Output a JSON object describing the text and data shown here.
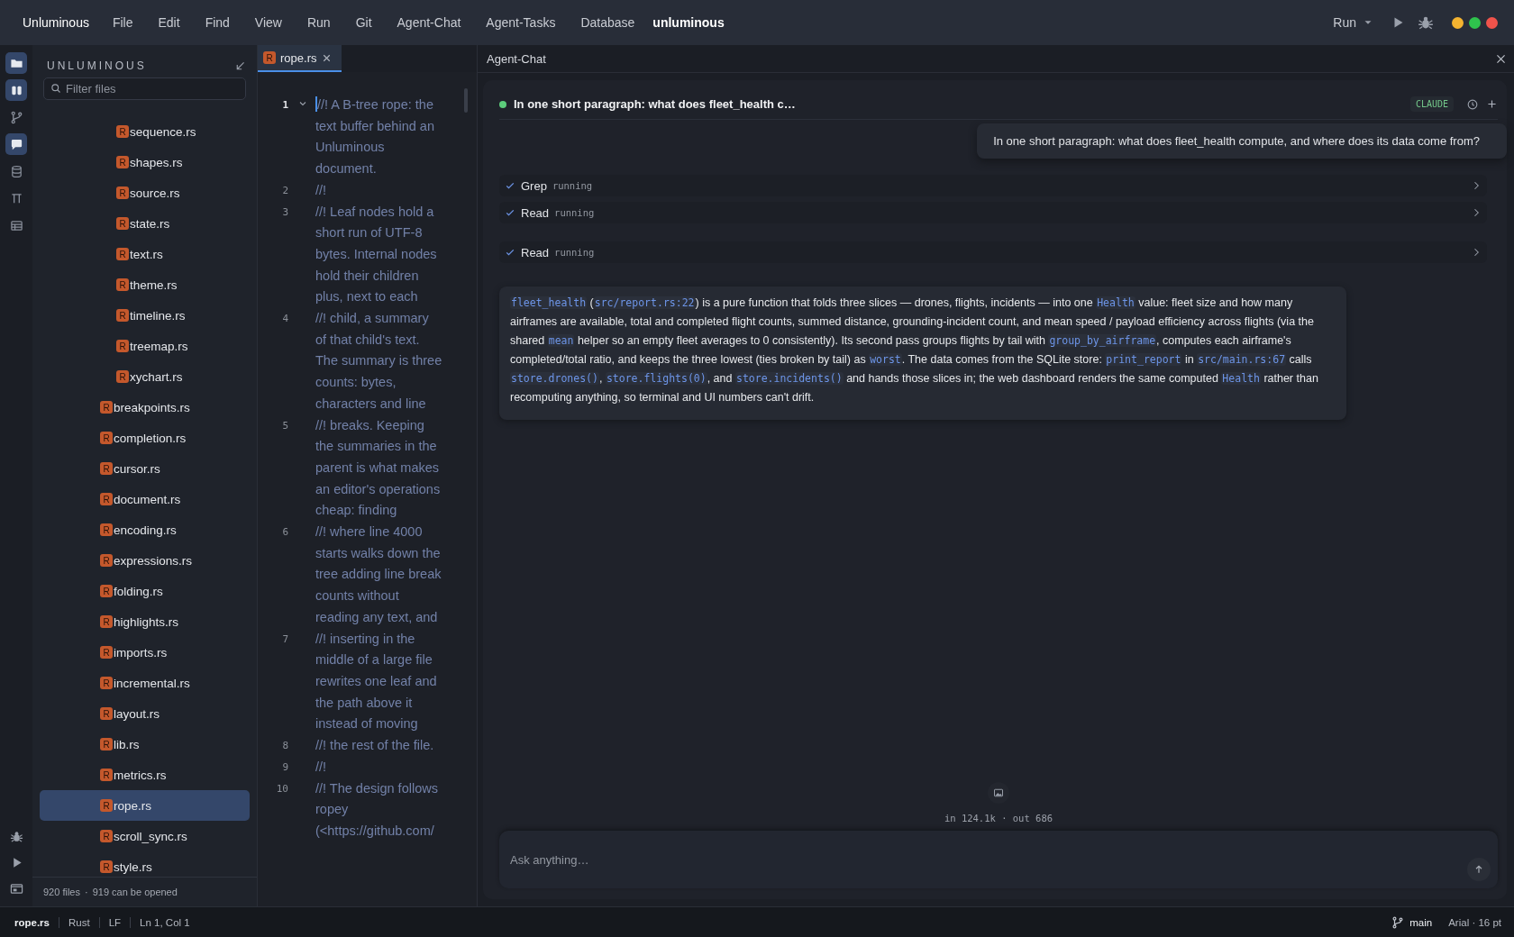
{
  "menu_bar": {
    "app_name": "Unluminous",
    "menus": [
      "File",
      "Edit",
      "Find",
      "View",
      "Run",
      "Git",
      "Agent-Chat",
      "Agent-Tasks",
      "Database"
    ],
    "project": "unluminous",
    "run_label": "Run"
  },
  "activity_bar": {
    "top": [
      {
        "kind": "folder",
        "selected": true
      },
      {
        "kind": "panels",
        "selected": true
      },
      {
        "kind": "branch",
        "selected": false
      },
      {
        "kind": "chat",
        "selected": true
      },
      {
        "kind": "database",
        "selected": false
      },
      {
        "kind": "pin",
        "selected": false
      },
      {
        "kind": "table",
        "selected": false
      }
    ],
    "bottom": [
      {
        "kind": "bug"
      },
      {
        "kind": "play"
      },
      {
        "kind": "terminal"
      }
    ]
  },
  "explorer": {
    "title": "UNLUMINOUS",
    "filter_placeholder": "Filter files",
    "subfolder_files": [
      {
        "name": "sequence.rs",
        "badge": "R",
        "selected": false
      },
      {
        "name": "shapes.rs",
        "badge": "R",
        "selected": false
      },
      {
        "name": "source.rs",
        "badge": "R",
        "selected": false
      },
      {
        "name": "state.rs",
        "badge": "R",
        "selected": false
      },
      {
        "name": "text.rs",
        "badge": "R",
        "selected": false
      },
      {
        "name": "theme.rs",
        "badge": "R",
        "selected": false
      },
      {
        "name": "timeline.rs",
        "badge": "R",
        "selected": false
      },
      {
        "name": "treemap.rs",
        "badge": "R",
        "selected": false
      },
      {
        "name": "xychart.rs",
        "badge": "R",
        "selected": false
      }
    ],
    "files": [
      {
        "name": "breakpoints.rs",
        "badge": "R",
        "selected": false
      },
      {
        "name": "completion.rs",
        "badge": "R",
        "selected": false
      },
      {
        "name": "cursor.rs",
        "badge": "R",
        "selected": false
      },
      {
        "name": "document.rs",
        "badge": "R",
        "selected": false
      },
      {
        "name": "encoding.rs",
        "badge": "R",
        "selected": false
      },
      {
        "name": "expressions.rs",
        "badge": "R",
        "selected": false
      },
      {
        "name": "folding.rs",
        "badge": "R",
        "selected": false
      },
      {
        "name": "highlights.rs",
        "badge": "R",
        "selected": false
      },
      {
        "name": "imports.rs",
        "badge": "R",
        "selected": false
      },
      {
        "name": "incremental.rs",
        "badge": "R",
        "selected": false
      },
      {
        "name": "layout.rs",
        "badge": "R",
        "selected": false
      },
      {
        "name": "lib.rs",
        "badge": "R",
        "selected": false
      },
      {
        "name": "metrics.rs",
        "badge": "R",
        "selected": false
      },
      {
        "name": "rope.rs",
        "badge": "R",
        "selected": true
      },
      {
        "name": "scroll_sync.rs",
        "badge": "R",
        "selected": false
      },
      {
        "name": "style.rs",
        "badge": "R",
        "selected": false
      }
    ],
    "footer": {
      "count": "920 files",
      "separator": "·",
      "openable": "919 can be opened"
    }
  },
  "editor": {
    "tabs": [
      {
        "name": "rope.rs",
        "badge": "R",
        "selected": true
      }
    ],
    "lines": [
      {
        "number": "1",
        "text": "//! A B-tree rope: the text buffer behind an Unluminous document.",
        "current": true
      },
      {
        "number": "2",
        "text": "//!",
        "current": false
      },
      {
        "number": "3",
        "text": "//! Leaf nodes hold a short run of UTF-8 bytes. Internal nodes hold their children plus, next to each",
        "current": false
      },
      {
        "number": "4",
        "text": "//! child, a summary of that child's text. The summary is three counts: bytes, characters and line",
        "current": false
      },
      {
        "number": "5",
        "text": "//! breaks. Keeping the summaries in the parent is what makes an editor's operations cheap: finding",
        "current": false
      },
      {
        "number": "6",
        "text": "//! where line 4000 starts walks down the tree adding line break counts without reading any text, and",
        "current": false
      },
      {
        "number": "7",
        "text": "//! inserting in the middle of a large file rewrites one leaf and the path above it instead of moving",
        "current": false
      },
      {
        "number": "8",
        "text": "//! the rest of the file.",
        "current": false
      },
      {
        "number": "9",
        "text": "//!",
        "current": false
      },
      {
        "number": "10",
        "text": "//! The design follows ropey (<https://github.com/",
        "current": false
      }
    ]
  },
  "agent_chat": {
    "panel_title": "Agent-Chat",
    "conversation_title": "In one short paragraph: what does fleet_health c…",
    "model_badge": "CLAUDE",
    "user_message": "In one short paragraph: what does fleet_health compute, and where does its data come from?",
    "tool_calls": [
      {
        "name": "Grep",
        "status": "running",
        "done": true
      },
      {
        "name": "Read",
        "status": "running",
        "done": true
      },
      {
        "name": "Read",
        "status": "running",
        "done": true
      }
    ],
    "answer": [
      {
        "kind": "code",
        "text": "fleet_health"
      },
      {
        "kind": "text",
        "text": " ("
      },
      {
        "kind": "code",
        "text": "src/report.rs:22"
      },
      {
        "kind": "text",
        "text": ") is a pure function that folds three slices — drones, flights, incidents — into one "
      },
      {
        "kind": "code",
        "text": "Health"
      },
      {
        "kind": "text",
        "text": " value: fleet size and how many airframes are available, total and completed flight counts, summed distance, grounding-incident count, and mean speed / payload efficiency across flights (via the shared "
      },
      {
        "kind": "code",
        "text": "mean"
      },
      {
        "kind": "text",
        "text": " helper so an empty fleet averages to 0 consistently). Its second pass groups flights by tail with "
      },
      {
        "kind": "code",
        "text": "group_by_airframe"
      },
      {
        "kind": "text",
        "text": ", computes each airframe's completed/total ratio, and keeps the three lowest (ties broken by tail) as "
      },
      {
        "kind": "code",
        "text": "worst"
      },
      {
        "kind": "text",
        "text": ". The data comes from the SQLite store: "
      },
      {
        "kind": "code",
        "text": "print_report"
      },
      {
        "kind": "text",
        "text": " in "
      },
      {
        "kind": "code",
        "text": "src/main.rs:67"
      },
      {
        "kind": "text",
        "text": " calls "
      },
      {
        "kind": "code",
        "text": "store.drones()"
      },
      {
        "kind": "text",
        "text": ", "
      },
      {
        "kind": "code",
        "text": "store.flights(0)"
      },
      {
        "kind": "text",
        "text": ", and "
      },
      {
        "kind": "code",
        "text": "store.incidents()"
      },
      {
        "kind": "text",
        "text": " and hands those slices in; the web dashboard renders the same computed "
      },
      {
        "kind": "code",
        "text": "Health"
      },
      {
        "kind": "text",
        "text": " rather than recomputing anything, so terminal and UI numbers can't drift."
      }
    ],
    "usage": "in 124.1k · out 686",
    "input_placeholder": "Ask anything…"
  },
  "status_bar": {
    "items": [
      "rope.rs",
      "Rust",
      "LF",
      "Ln 1, Col 1"
    ],
    "branch": "main",
    "font": "Arial · 16 pt"
  }
}
